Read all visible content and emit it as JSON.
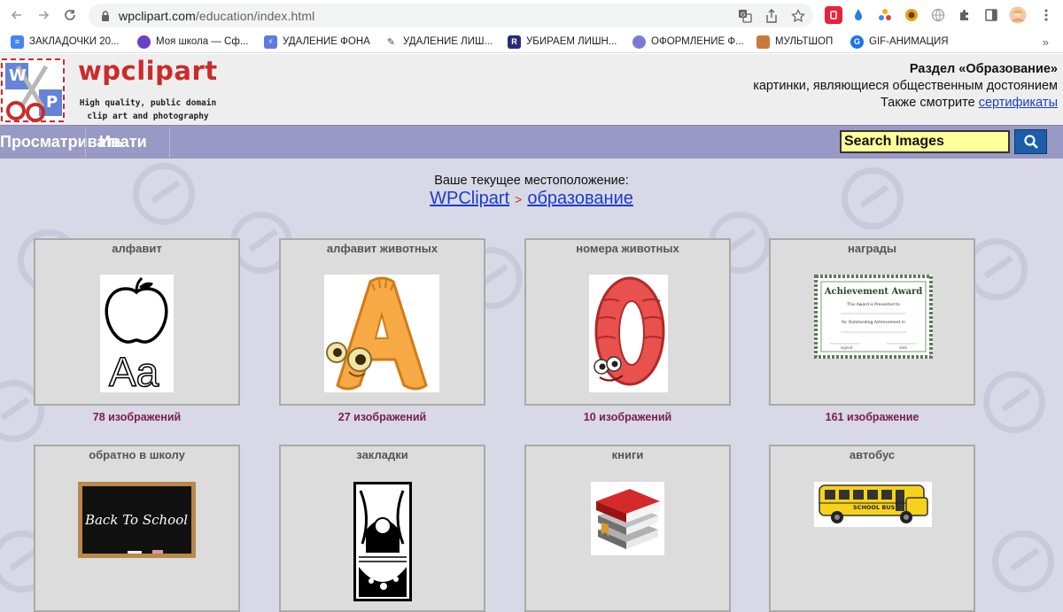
{
  "browser": {
    "url_host": "wpclipart.com",
    "url_path": "/education/index.html"
  },
  "bookmarks": [
    {
      "label": "ЗАКЛАДОЧКИ 20...",
      "icon": "docs-icon",
      "color": "#4285f4"
    },
    {
      "label": "Моя школа — Сф...",
      "icon": "sphere-icon",
      "color": "#6a3fc9"
    },
    {
      "label": "УДАЛЕНИЕ ФОНА",
      "icon": "remove-bg-icon",
      "color": "#5b7be0"
    },
    {
      "label": "УДАЛЕНИЕ ЛИШ...",
      "icon": "wand-icon",
      "color": "#444444"
    },
    {
      "label": "УБИРАЕМ ЛИШН...",
      "icon": "r-icon",
      "color": "#2a2a7a"
    },
    {
      "label": "ОФОРМЛЕНИЕ Ф...",
      "icon": "design-icon",
      "color": "#7b7bd6"
    },
    {
      "label": "МУЛЬТШОП",
      "icon": "multshop-icon",
      "color": "#c97a3a"
    },
    {
      "label": "GIF-АНИМАЦИЯ",
      "icon": "gif-icon",
      "color": "#1a73e8"
    }
  ],
  "bookmarks_more": "»",
  "site": {
    "logo_text": "wpclipart",
    "logo_letters": {
      "w": "W",
      "p": "P"
    },
    "tagline_line1": "High quality, public domain",
    "tagline_line2": "clip art and photography",
    "section_title": "Раздел «Образование»",
    "section_sub": "картинки, являющиеся общественным достоянием",
    "see_also": "Также смотрите",
    "see_also_link": "сертификаты"
  },
  "menu": {
    "item1": "Просматривать",
    "item2": "Ивати",
    "search_placeholder": "Search Images"
  },
  "location": {
    "label": "Ваше текущее местоположение:",
    "root": "WPClipart",
    "separator": ">",
    "current": "образование"
  },
  "categories": [
    {
      "title": "алфавит",
      "count": "78 изображений"
    },
    {
      "title": "алфавит животных",
      "count": "27 изображений"
    },
    {
      "title": "номера животных",
      "count": "10 изображений"
    },
    {
      "title": "награды",
      "count": "161 изображение"
    },
    {
      "title": "обратно в школу",
      "count": ""
    },
    {
      "title": "закладки",
      "count": ""
    },
    {
      "title": "книги",
      "count": ""
    },
    {
      "title": "автобус",
      "count": ""
    }
  ],
  "thumbs": {
    "alphabet_caption": "Aa",
    "award_title": "Achievement Award",
    "award_line1": "This Award is Presented to",
    "award_line2": "for Outstanding Achievement in",
    "award_signed": "signed",
    "award_date": "date",
    "chalk_text": "Back To School",
    "bus_text": "SCHOOL BUS"
  }
}
